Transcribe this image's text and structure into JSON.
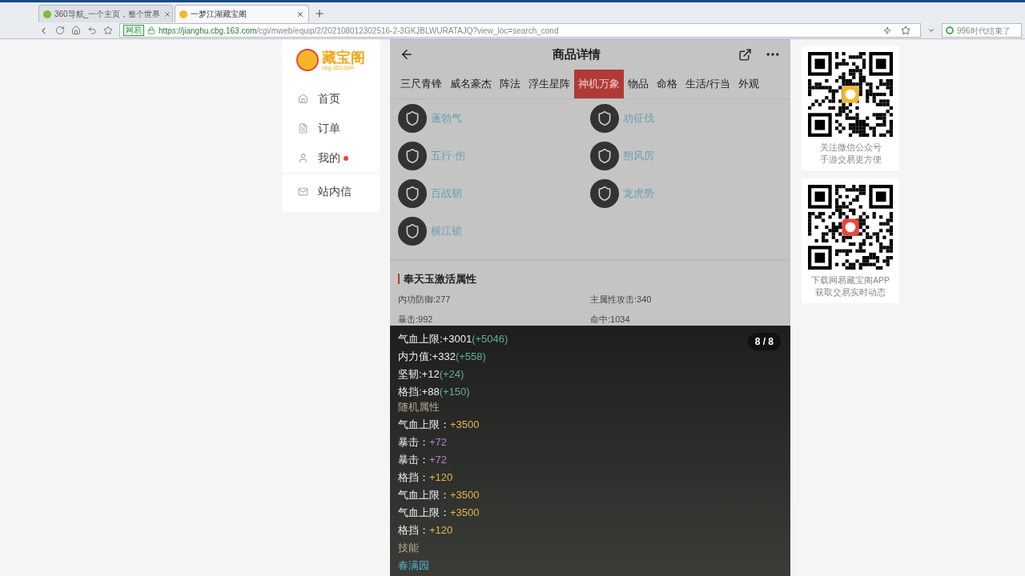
{
  "browser": {
    "tabs": [
      {
        "title": "360导航_一个主页，整个世界",
        "selected": false
      },
      {
        "title": "一梦江湖藏宝阁",
        "selected": true
      }
    ],
    "site_badge": "网易",
    "url_host": "https://jianghu.cbg.163.com",
    "url_path": "/cgi/mweb/equip/2/202108012302516-2-3GKJBLWURATAJQ?view_loc=search_cond",
    "search": {
      "placeholder": "996时代结束了"
    }
  },
  "sidebar": {
    "logo": {
      "name": "藏宝阁",
      "domain": "cbg.163.com"
    },
    "items": [
      {
        "label": "首页",
        "dot": false
      },
      {
        "label": "订单",
        "dot": false
      },
      {
        "label": "我的",
        "dot": true
      },
      {
        "label": "站内信",
        "dot": false
      }
    ]
  },
  "header": {
    "title": "商品详情"
  },
  "tabs": [
    {
      "label": "三尺青锋",
      "selected": false
    },
    {
      "label": "威名豪杰",
      "selected": false
    },
    {
      "label": "阵法",
      "selected": false
    },
    {
      "label": "浮生星阵",
      "selected": false
    },
    {
      "label": "神机万象",
      "selected": true
    },
    {
      "label": "物品",
      "selected": false
    },
    {
      "label": "命格",
      "selected": false
    },
    {
      "label": "生活/行当",
      "selected": false
    },
    {
      "label": "外观",
      "selected": false
    }
  ],
  "skills": [
    "蓬勃气",
    "劝征伐",
    "五行·伤",
    "朔风厉",
    "百战韧",
    "龙虎势",
    "横江锁"
  ],
  "jade": {
    "title": "奉天玉激活属性",
    "stats": [
      "内功防御:277",
      "主属性攻击:340",
      "暴击:992",
      "命中:1034"
    ]
  },
  "popup": {
    "counter": "8 / 8",
    "lines": [
      {
        "kind": "base",
        "label": "气血上限:+3001",
        "bonus": "(+5046)"
      },
      {
        "kind": "base",
        "label": "内力值:+332",
        "bonus": "(+558)"
      },
      {
        "kind": "base",
        "label": "坚韧:+12",
        "bonus": "(+24)"
      },
      {
        "kind": "base",
        "label": "格挡:+88",
        "bonus": "(+150)"
      },
      {
        "kind": "heading",
        "label": "随机属性"
      },
      {
        "kind": "random",
        "label": "气血上限：",
        "value": "+3500",
        "color": "#e3b54c"
      },
      {
        "kind": "random",
        "label": "暴击：",
        "value": "+72",
        "color": "#b27fd6"
      },
      {
        "kind": "random",
        "label": "暴击：",
        "value": "+72",
        "color": "#b27fd6"
      },
      {
        "kind": "random",
        "label": "格挡：",
        "value": "+120",
        "color": "#e3b54c"
      },
      {
        "kind": "random",
        "label": "气血上限：",
        "value": "+3500",
        "color": "#e3b54c"
      },
      {
        "kind": "random",
        "label": "气血上限：",
        "value": "+3500",
        "color": "#e3b54c"
      },
      {
        "kind": "random",
        "label": "格挡：",
        "value": "+120",
        "color": "#e3b54c"
      },
      {
        "kind": "heading",
        "label": "技能"
      },
      {
        "kind": "skill",
        "label": "春满园"
      }
    ]
  },
  "qr_cards": [
    {
      "caption": "关注微信公众号",
      "caption2": "手游交易更方便"
    },
    {
      "caption": "下载网易藏宝阁APP",
      "caption2": "获取交易实时动态"
    }
  ]
}
